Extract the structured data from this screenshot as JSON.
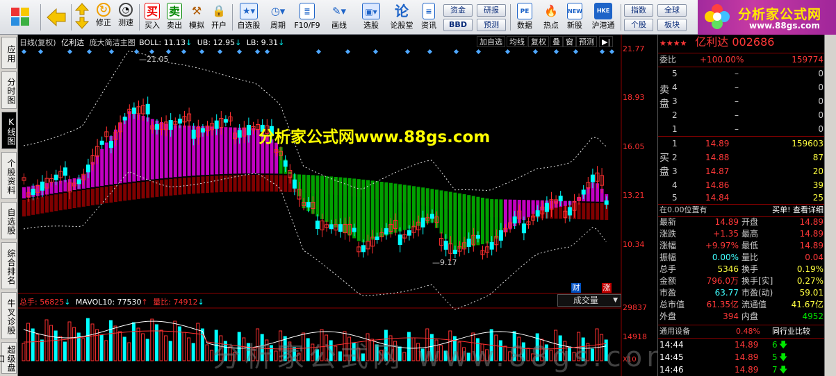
{
  "toolbar": {
    "items": [
      "修正",
      "测速",
      "买入",
      "卖出",
      "模拟",
      "开户",
      "自选股",
      "周期",
      "F10/F9",
      "画线",
      "选股",
      "论股堂",
      "资讯",
      "数据",
      "热点",
      "新股",
      "沪港通"
    ],
    "box_buttons": [
      "资金",
      "研报",
      "BBD",
      "预测",
      "指数",
      "全球",
      "个股",
      "板块"
    ],
    "icon_glyphs": {
      "buy": "买",
      "sell": "卖",
      "lun": "论",
      "pe": "PE",
      "new": "NEW",
      "hk": "HKE"
    }
  },
  "logo": {
    "title": "分析家公式网",
    "url": "www.88gs.com"
  },
  "side_tabs": [
    {
      "label": "应用",
      "active": false
    },
    {
      "label": "分时图",
      "active": false
    },
    {
      "label": "K线图",
      "active": true
    },
    {
      "label": "个股资料",
      "active": false
    },
    {
      "label": "自选股",
      "active": false
    },
    {
      "label": "综合排名",
      "active": false
    },
    {
      "label": "牛叉诊股",
      "active": false
    },
    {
      "label": "超级盘口",
      "active": false
    }
  ],
  "chart": {
    "header": {
      "period": "日线(复权)",
      "name": "亿利达",
      "formula": "庞大简洁主图",
      "boll": "BOLL: 11.13",
      "ub": "UB: 12.95",
      "lb": "LB: 9.31"
    },
    "buttons": [
      "加自选",
      "均线",
      "复权",
      "叠",
      "窗",
      "预测"
    ],
    "price_ticks": [
      "21.77",
      "18.93",
      "16.05",
      "13.21",
      "10.34"
    ],
    "high_label": "21.05",
    "low_label": "9.17",
    "watermark": "分析家公式网www.88gs.com",
    "bottom_watermark": "分析家公式网 www.88gs.com",
    "badges": {
      "cai": "财",
      "zhang": "涨"
    },
    "vol_header": {
      "total": "总手: 56825",
      "mavol": "MAVOL10: 77530",
      "ratio": "量比: 74912"
    },
    "vol_select": "成交量",
    "vol_ticks": [
      "29837",
      "14918"
    ],
    "vol_unit": "X10",
    "colors": {
      "up": "#ff3030",
      "down": "#00ffff",
      "magenta": "#c000c0",
      "green": "#00a000",
      "maroon": "#800000"
    }
  },
  "quote": {
    "title": "亿利达 002686",
    "stars": "★★★★",
    "weibi_label": "委比",
    "weibi": "+100.00%",
    "weibi_vol": "159774",
    "sell_label": "卖盘",
    "buy_label": "买盘",
    "sell": [
      {
        "n": "5",
        "p": "–",
        "v": "0"
      },
      {
        "n": "4",
        "p": "–",
        "v": "0"
      },
      {
        "n": "3",
        "p": "–",
        "v": "0"
      },
      {
        "n": "2",
        "p": "–",
        "v": "0"
      },
      {
        "n": "1",
        "p": "–",
        "v": "0"
      }
    ],
    "buy": [
      {
        "n": "1",
        "p": "14.89",
        "v": "159603"
      },
      {
        "n": "2",
        "p": "14.88",
        "v": "87"
      },
      {
        "n": "3",
        "p": "14.87",
        "v": "20"
      },
      {
        "n": "4",
        "p": "14.86",
        "v": "39"
      },
      {
        "n": "5",
        "p": "14.84",
        "v": "25"
      }
    ],
    "pos_text": "在0.00位置有",
    "detail": "买单! 查看详细",
    "stats": [
      {
        "l1": "最新",
        "v1": "14.89",
        "l2": "开盘",
        "v2": "14.89"
      },
      {
        "l1": "涨跌",
        "v1": "+1.35",
        "l2": "最高",
        "v2": "14.89"
      },
      {
        "l1": "涨幅",
        "v1": "+9.97%",
        "l2": "最低",
        "v2": "14.89"
      },
      {
        "l1": "振幅",
        "v1": "0.00%",
        "l2": "量比",
        "v2": "0.04"
      },
      {
        "l1": "总手",
        "v1": "5346",
        "l2": "换手",
        "v2": "0.19%"
      },
      {
        "l1": "金额",
        "v1": "796.0万",
        "l2": "换手[实]",
        "v2": "0.27%"
      },
      {
        "l1": "市盈",
        "v1": "63.77",
        "l2": "市盈(动)",
        "v2": "59.01"
      },
      {
        "l1": "总市值",
        "v1": "61.35亿",
        "l2": "流通值",
        "v2": "41.67亿"
      },
      {
        "l1": "外盘",
        "v1": "394",
        "l2": "内盘",
        "v2": "4952"
      }
    ],
    "industry": "通用设备",
    "industry_pct": "0.48%",
    "industry_btn": "同行业比较",
    "ticks": [
      {
        "t": "14:44",
        "p": "14.89",
        "v": "6"
      },
      {
        "t": "14:45",
        "p": "14.89",
        "v": "5"
      },
      {
        "t": "14:46",
        "p": "14.89",
        "v": "7"
      }
    ]
  }
}
